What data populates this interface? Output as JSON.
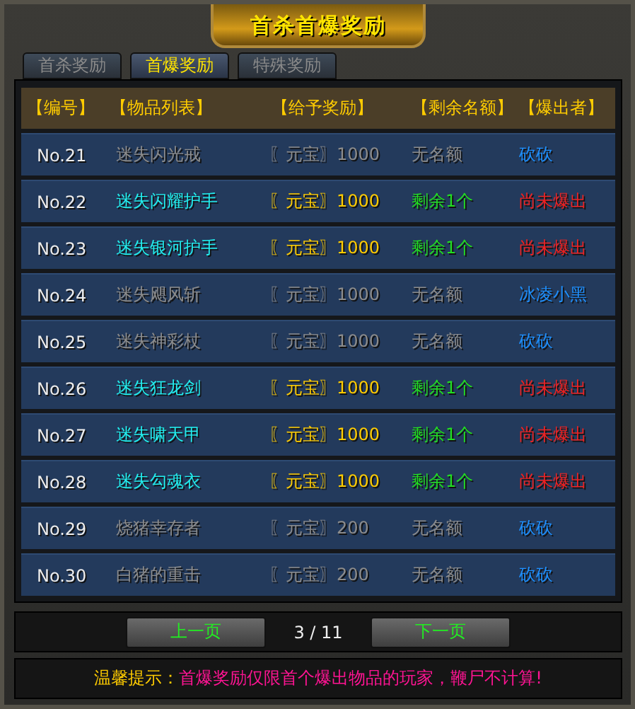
{
  "window": {
    "title": "首杀首爆奖励"
  },
  "tabs": [
    {
      "label": "首杀奖励",
      "selected": false
    },
    {
      "label": "首爆奖励",
      "selected": true
    },
    {
      "label": "特殊奖励",
      "selected": false
    }
  ],
  "table": {
    "columns": [
      "【编号】",
      "【物品列表】",
      "【给予奖励】",
      "【剩余名额】",
      "【爆出者】"
    ],
    "rows": [
      {
        "kind": "claimed",
        "number": "No.21",
        "item": "迷失闪光戒",
        "reward": "〖元宝〗1000",
        "remaining": "无名额",
        "finder": "砍砍"
      },
      {
        "kind": "open",
        "number": "No.22",
        "item": "迷失闪耀护手",
        "reward": "〖元宝〗1000",
        "remaining": "剩余1个",
        "finder": "尚未爆出"
      },
      {
        "kind": "open",
        "number": "No.23",
        "item": "迷失银河护手",
        "reward": "〖元宝〗1000",
        "remaining": "剩余1个",
        "finder": "尚未爆出"
      },
      {
        "kind": "claimed",
        "number": "No.24",
        "item": "迷失飓风斩",
        "reward": "〖元宝〗1000",
        "remaining": "无名额",
        "finder": "冰凌小黑"
      },
      {
        "kind": "claimed",
        "number": "No.25",
        "item": "迷失神彩杖",
        "reward": "〖元宝〗1000",
        "remaining": "无名额",
        "finder": "砍砍"
      },
      {
        "kind": "open",
        "number": "No.26",
        "item": "迷失狂龙剑",
        "reward": "〖元宝〗1000",
        "remaining": "剩余1个",
        "finder": "尚未爆出"
      },
      {
        "kind": "open",
        "number": "No.27",
        "item": "迷失啸天甲",
        "reward": "〖元宝〗1000",
        "remaining": "剩余1个",
        "finder": "尚未爆出"
      },
      {
        "kind": "open",
        "number": "No.28",
        "item": "迷失勾魂衣",
        "reward": "〖元宝〗1000",
        "remaining": "剩余1个",
        "finder": "尚未爆出"
      },
      {
        "kind": "claimed",
        "number": "No.29",
        "item": "烧猪幸存者",
        "reward": "〖元宝〗200",
        "remaining": "无名额",
        "finder": "砍砍"
      },
      {
        "kind": "claimed",
        "number": "No.30",
        "item": "白猪的重击",
        "reward": "〖元宝〗200",
        "remaining": "无名额",
        "finder": "砍砍"
      }
    ]
  },
  "pagination": {
    "previous": "上一页",
    "page": "3 / 11",
    "next": "下一页"
  },
  "tip": {
    "label": "温馨提示：",
    "text": "首爆奖励仅限首个爆出物品的玩家，鞭尸不计算!"
  }
}
